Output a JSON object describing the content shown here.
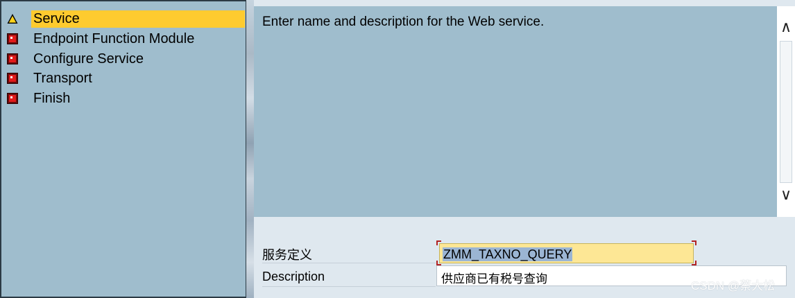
{
  "steps": [
    {
      "label": "Service",
      "icon": "warning-icon",
      "active": true
    },
    {
      "label": "Endpoint Function Module",
      "icon": "error-stop-icon"
    },
    {
      "label": "Configure Service",
      "icon": "error-stop-icon"
    },
    {
      "label": "Transport",
      "icon": "error-stop-icon"
    },
    {
      "label": "Finish",
      "icon": "error-stop-icon"
    }
  ],
  "info": {
    "text": "Enter name and description for the Web service."
  },
  "form": {
    "name_label": "服务定义",
    "name_value": "ZMM_TAXNO_QUERY",
    "description_label": "Description",
    "description_value": "供应商已有税号查询"
  },
  "scrollbar": {
    "up": "∧",
    "down": "∨"
  },
  "watermark": "CSDN @蔡大松",
  "colors": {
    "active_step": "#fecb2f",
    "panel": "#9fbdcd",
    "required_corner": "#b22222"
  }
}
